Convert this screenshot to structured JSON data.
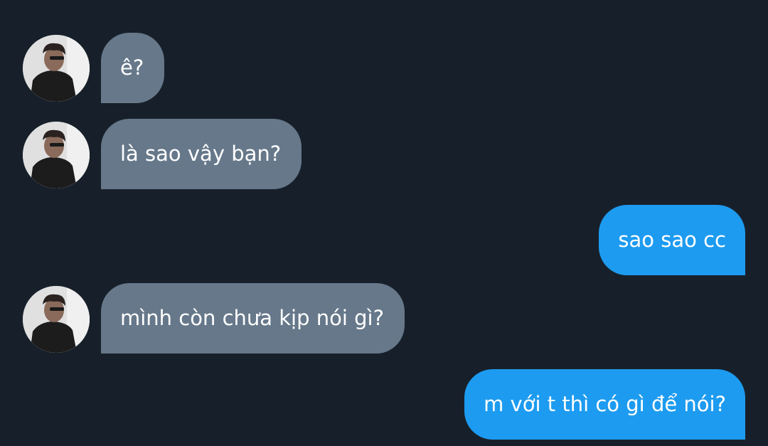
{
  "messages": [
    {
      "direction": "incoming",
      "text": "ê?",
      "avatar": "profile-photo-icon"
    },
    {
      "direction": "incoming",
      "text": "là sao vậy bạn?",
      "avatar": "profile-photo-icon"
    },
    {
      "direction": "outgoing",
      "text": "sao sao cc"
    },
    {
      "direction": "incoming",
      "text": "mình còn chưa kịp nói gì?",
      "avatar": "profile-photo-icon"
    },
    {
      "direction": "outgoing",
      "text": "m với t thì có gì để nói?"
    }
  ],
  "colors": {
    "background": "#17202a",
    "incoming_bubble": "#66788a",
    "outgoing_bubble": "#1d9bf0",
    "text": "#ffffff"
  }
}
